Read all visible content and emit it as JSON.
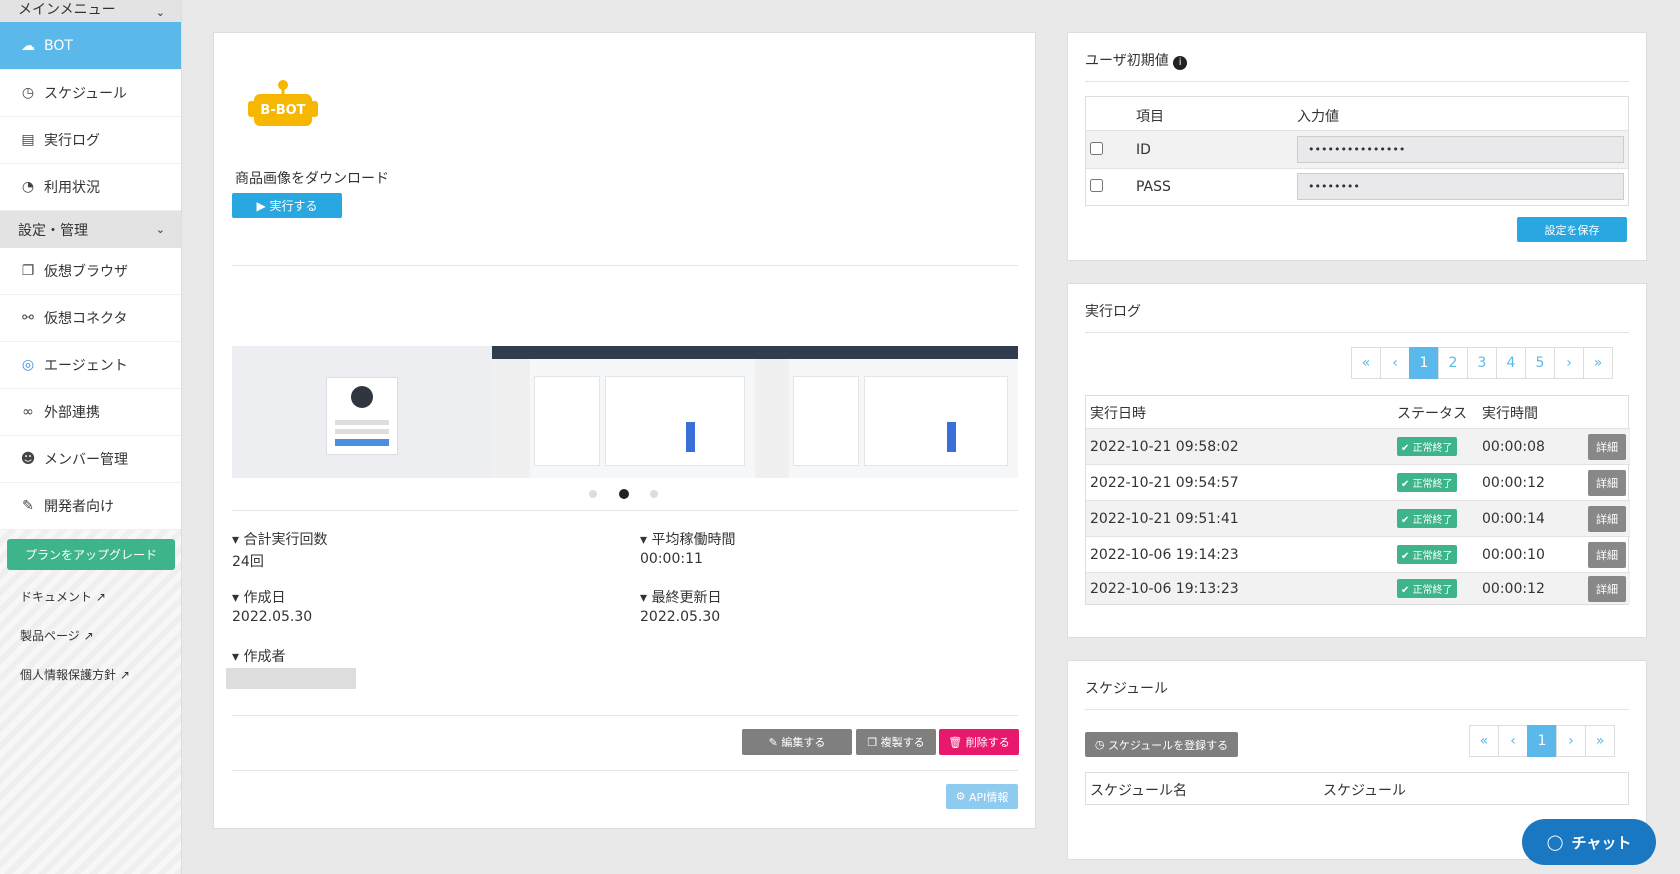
{
  "sidebar": {
    "main_menu": "メインメニュー",
    "items": [
      {
        "label": "BOT",
        "icon": "bot-icon"
      },
      {
        "label": "スケジュール",
        "icon": "clock-icon"
      },
      {
        "label": "実行ログ",
        "icon": "file-icon"
      },
      {
        "label": "利用状況",
        "icon": "pie-chart-icon"
      }
    ],
    "settings_menu": "設定・管理",
    "settings_items": [
      {
        "label": "仮想ブラウザ",
        "icon": "browser-icon"
      },
      {
        "label": "仮想コネクタ",
        "icon": "connector-icon"
      },
      {
        "label": "エージェント",
        "icon": "agent-icon"
      },
      {
        "label": "外部連携",
        "icon": "link-icon"
      },
      {
        "label": "メンバー管理",
        "icon": "users-icon"
      },
      {
        "label": "開発者向け",
        "icon": "wrench-icon"
      }
    ],
    "upgrade": "プランをアップグレード",
    "links": [
      "ドキュメント",
      "製品ページ",
      "個人情報保護方針"
    ]
  },
  "bot": {
    "logo_text": "B-BOT",
    "name": "商品画像をダウンロード",
    "run_label": "▶ 実行する",
    "carousel_active": 2,
    "stats": {
      "total_runs_label": "合計実行回数",
      "total_runs": "24回",
      "avg_time_label": "平均稼働時間",
      "avg_time": "00:00:11",
      "created_label": "作成日",
      "created": "2022.05.30",
      "updated_label": "最終更新日",
      "updated": "2022.05.30",
      "author_label": "作成者"
    },
    "edit_label": "編集する",
    "copy_label": "複製する",
    "delete_label": "削除する",
    "api_label": "API情報"
  },
  "user_defaults": {
    "title": "ユーザ初期値",
    "col_item": "項目",
    "col_value": "入力値",
    "rows": [
      {
        "item": "ID",
        "value": "•••••••••••••••"
      },
      {
        "item": "PASS",
        "value": "••••••••"
      }
    ],
    "save_label": "設定を保存"
  },
  "exec_log": {
    "title": "実行ログ",
    "pages": [
      "1",
      "2",
      "3",
      "4",
      "5"
    ],
    "current_page": "1",
    "col_datetime": "実行日時",
    "col_status": "ステータス",
    "col_duration": "実行時間",
    "rows": [
      {
        "datetime": "2022-10-21 09:58:02",
        "status": "正常終了",
        "duration": "00:00:08",
        "detail": "詳細"
      },
      {
        "datetime": "2022-10-21 09:54:57",
        "status": "正常終了",
        "duration": "00:00:12",
        "detail": "詳細"
      },
      {
        "datetime": "2022-10-21 09:51:41",
        "status": "正常終了",
        "duration": "00:00:14",
        "detail": "詳細"
      },
      {
        "datetime": "2022-10-06 19:14:23",
        "status": "正常終了",
        "duration": "00:00:10",
        "detail": "詳細"
      },
      {
        "datetime": "2022-10-06 19:13:23",
        "status": "正常終了",
        "duration": "00:00:12",
        "detail": "詳細"
      }
    ]
  },
  "schedule": {
    "title": "スケジュール",
    "register_label": "スケジュールを登録する",
    "pages": [
      "1"
    ],
    "col_name": "スケジュール名",
    "col_schedule": "スケジュール"
  },
  "chat": {
    "label": "チャット"
  },
  "colors": {
    "accent": "#5ab9ea",
    "success": "#3db489",
    "danger": "#e8186d",
    "gray_button": "#7f7f7f"
  }
}
